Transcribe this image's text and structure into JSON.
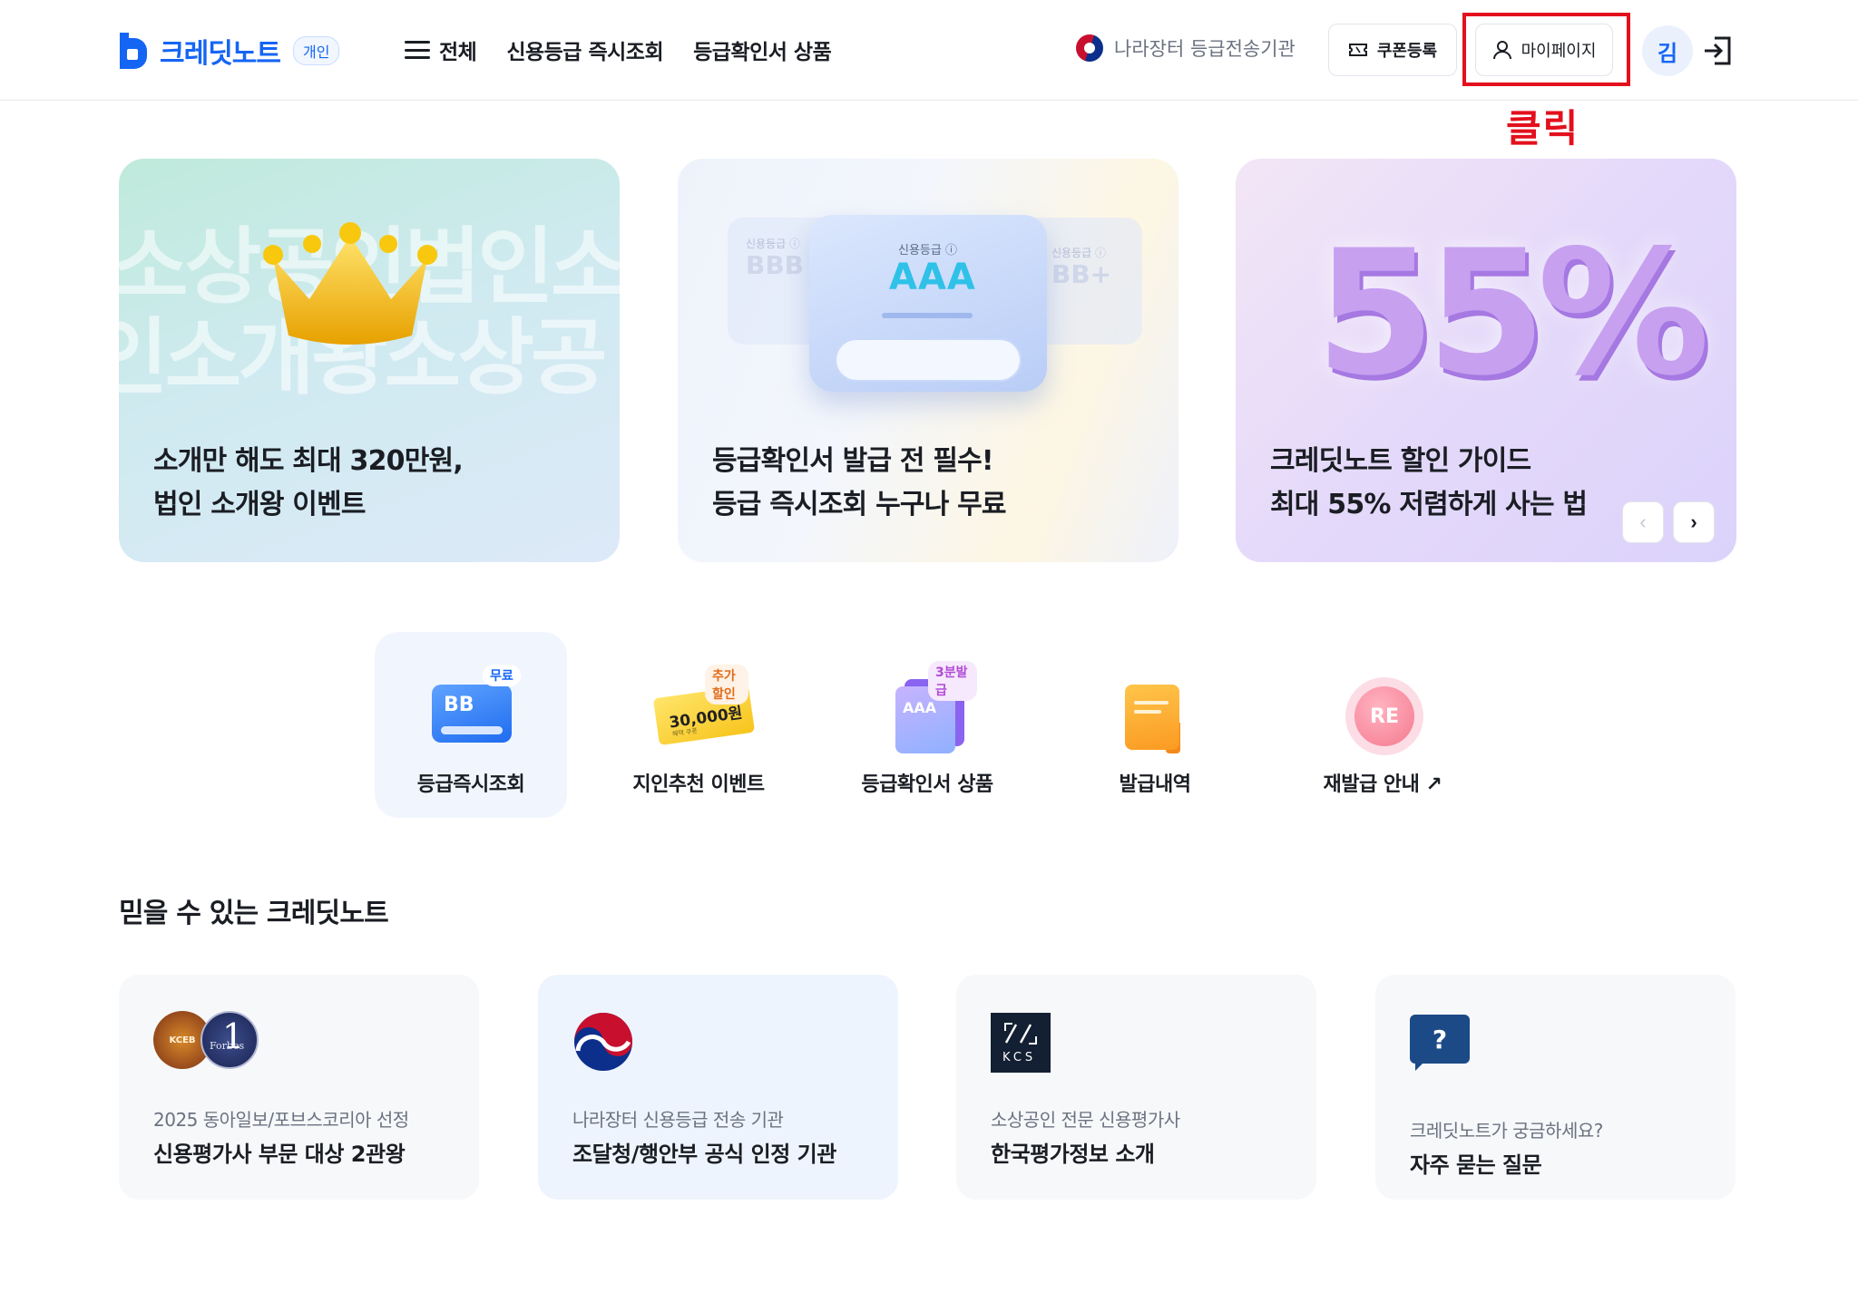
{
  "header": {
    "logo_text": "크레딧노트",
    "logo_badge": "개인",
    "nav": [
      "전체",
      "신용등급 즉시조회",
      "등급확인서 상품"
    ],
    "gov_link": "나라장터 등급전송기관",
    "coupon_button": "쿠폰등록",
    "mypage_button": "마이페이지",
    "avatar_initial": "김",
    "click_annotation": "클릭"
  },
  "banners": [
    {
      "bg_line1": "소상공인법인소",
      "bg_line2": "인소개왕소상공",
      "title_line1": "소개만 해도 최대 320만원,",
      "title_line2": "법인 소개왕 이벤트"
    },
    {
      "card_label": "신용등급 ⓘ",
      "card_grade": "AAA",
      "side_left_label": "신용등급 ⓘ",
      "side_left_grade": "BBB",
      "side_right_label": "신용등급 ⓘ",
      "side_right_grade": "BB+",
      "title_line1": "등급확인서 발급 전 필수!",
      "title_line2": "등급 즉시조회 누구나 무료"
    },
    {
      "big_text": "55%",
      "title_line1": "크레딧노트 할인 가이드",
      "title_line2": "최대 55% 저렴하게 사는 법"
    }
  ],
  "carousel": {
    "prev": "‹",
    "next": "›"
  },
  "quick_menu": [
    {
      "label": "등급즉시조회",
      "badge": "무료",
      "icon": "bb-card-icon",
      "icon_text": "BB"
    },
    {
      "label": "지인추천 이벤트",
      "badge": "추가할인",
      "icon": "ticket-icon",
      "icon_text": "30,000원",
      "icon_subtext": "혜택 쿠폰"
    },
    {
      "label": "등급확인서 상품",
      "badge": "3분발급",
      "icon": "document-stack-icon",
      "icon_text": "AAA"
    },
    {
      "label": "발급내역",
      "icon": "orange-doc-icon"
    },
    {
      "label": "재발급 안내 ↗",
      "icon": "re-badge-icon",
      "icon_text": "RE"
    }
  ],
  "trust": {
    "title": "믿을 수 있는 크레딧노트",
    "cards": [
      {
        "icon": "award-medal-icon",
        "icon_text_left": "KCEB",
        "icon_text_right": "Forbes",
        "icon_number": "1",
        "sub": "2025 동아일보/포브스코리아 선정",
        "main": "신용평가사 부문 대상 2관왕"
      },
      {
        "icon": "korea-gov-emblem-icon",
        "sub": "나라장터 신용등급 전송 기관",
        "main": "조달청/행안부 공식 인정 기관"
      },
      {
        "icon": "kcs-logo-icon",
        "icon_text": "KCS",
        "sub": "소상공인 전문 신용평가사",
        "main": "한국평가정보 소개"
      },
      {
        "icon": "question-bubble-icon",
        "icon_text": "?",
        "sub": "크레딧노트가 궁금하세요?",
        "main": "자주 묻는 질문"
      }
    ]
  },
  "colors": {
    "brand": "#1565f5",
    "annotation": "#e3101d"
  }
}
